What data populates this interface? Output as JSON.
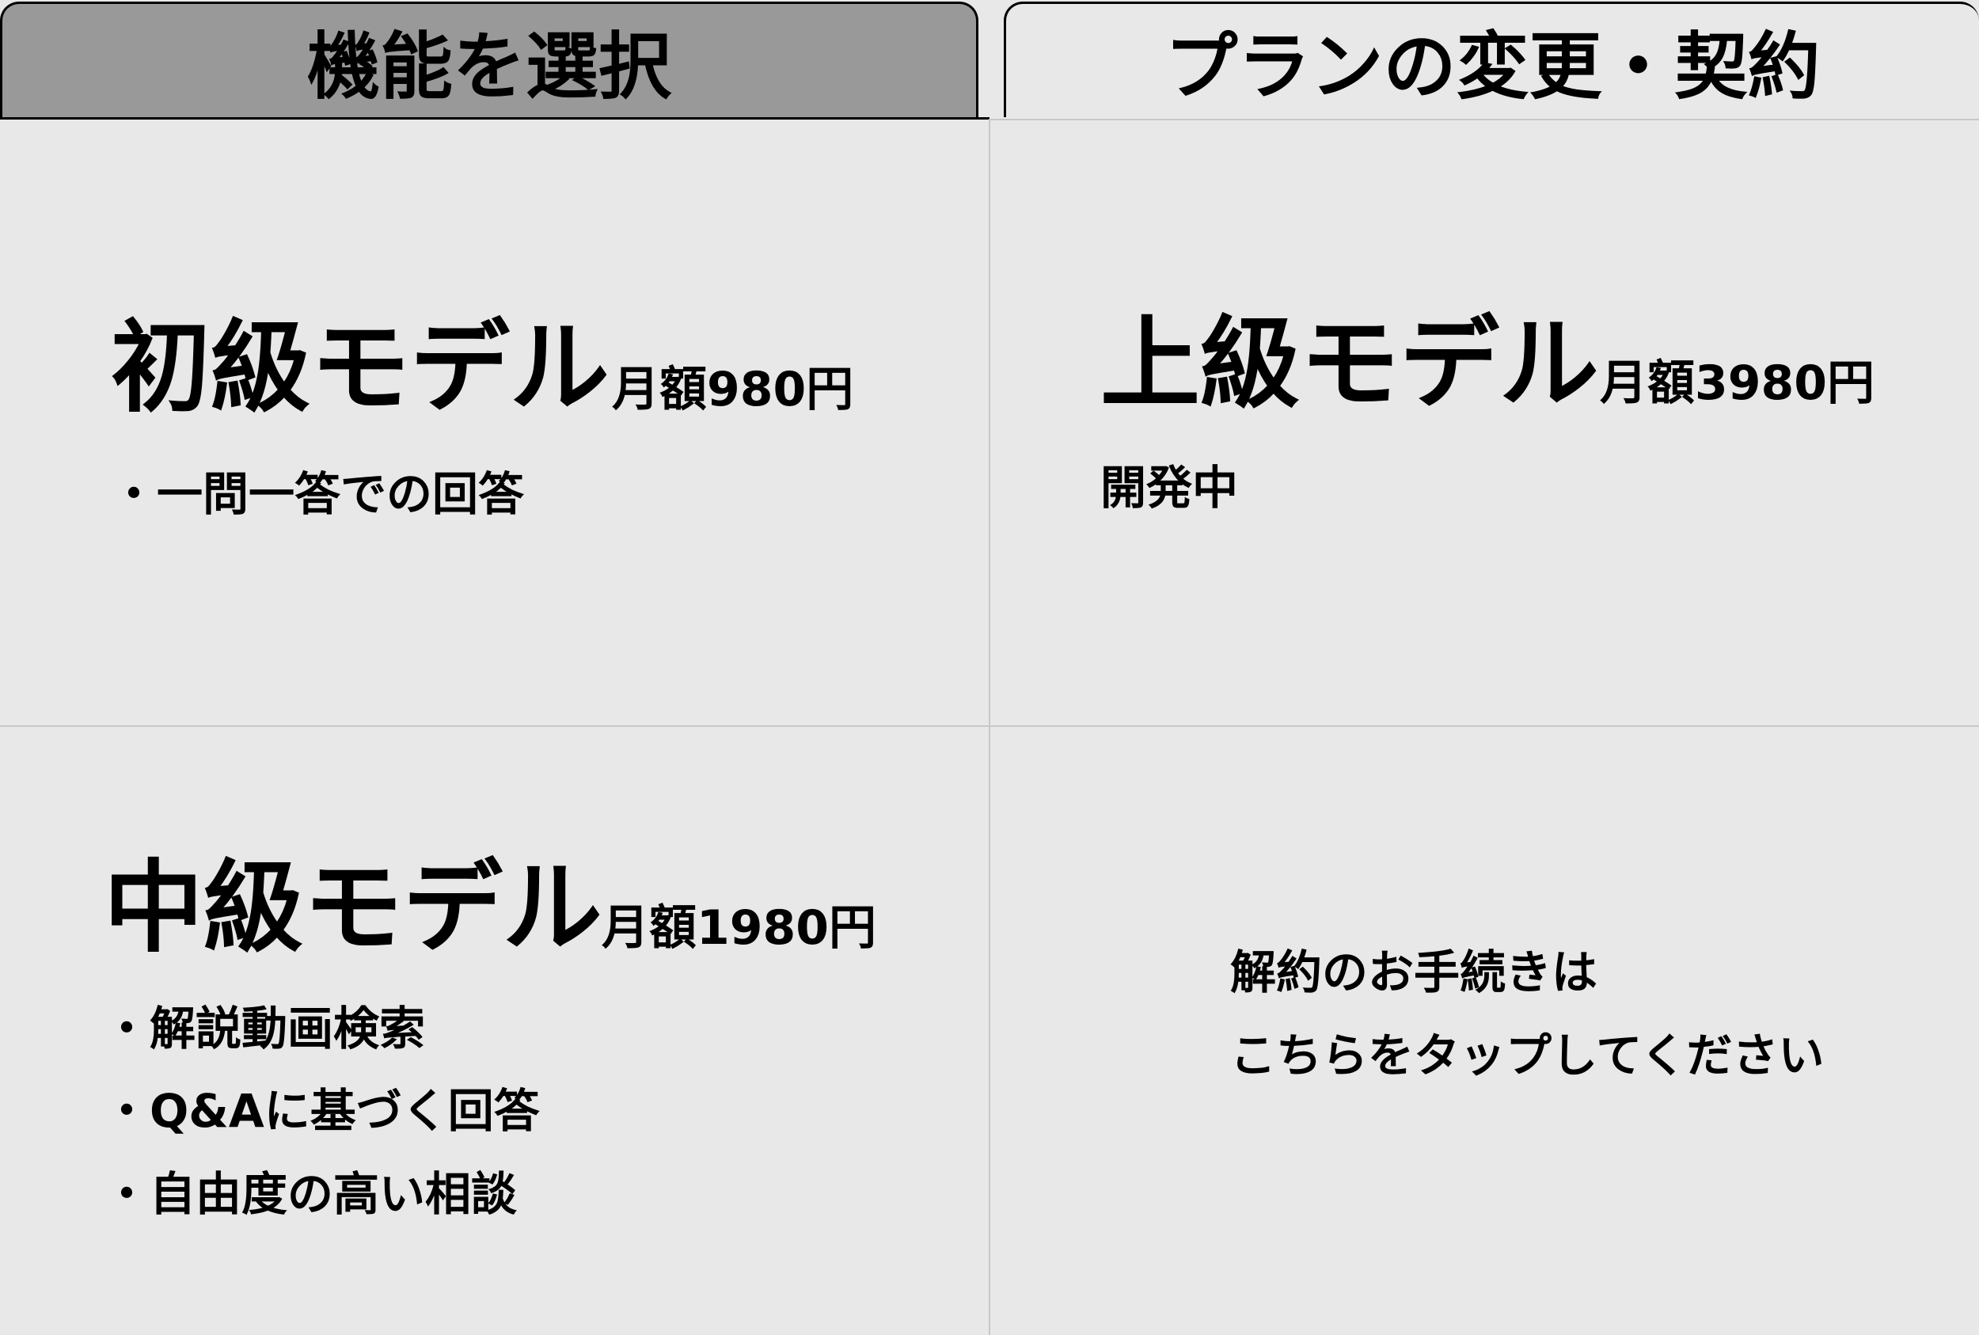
{
  "tabs": [
    {
      "label": "機能を選択",
      "active": true
    },
    {
      "label": "プランの変更・契約",
      "active": false
    }
  ],
  "plans": {
    "beginner": {
      "name": "初級モデル",
      "price": "月額980円",
      "features": [
        "・一問一答での回答"
      ]
    },
    "advanced": {
      "name": "上級モデル",
      "price": "月額3980円",
      "status": "開発中"
    },
    "intermediate": {
      "name": "中級モデル",
      "price": "月額1980円",
      "features": [
        "・解説動画検索",
        "・Q&Aに基づく回答",
        "・自由度の高い相談"
      ]
    }
  },
  "cancel": {
    "line1": "解約のお手続きは",
    "line2": "こちらをタップしてください"
  },
  "colors": {
    "active_tab": "#999999",
    "background": "#e8e8e8",
    "divider": "#c8c8c8"
  }
}
